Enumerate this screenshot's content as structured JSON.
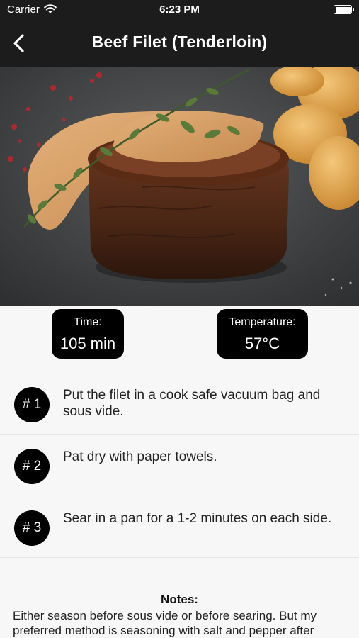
{
  "status_bar": {
    "carrier": "Carrier",
    "time": "6:23 PM"
  },
  "nav": {
    "title": "Beef Filet (Tenderloin)"
  },
  "stats": {
    "time_label": "Time:",
    "time_value": "105 min",
    "temperature_label": "Temperature:",
    "temperature_value": "57°C"
  },
  "steps": [
    {
      "badge": "# 1",
      "text": "Put the filet in a cook safe vacuum bag and sous vide."
    },
    {
      "badge": "# 2",
      "text": "Pat dry with paper towels."
    },
    {
      "badge": "# 3",
      "text": "Sear in a pan for a 1-2 minutes on each side."
    }
  ],
  "notes": {
    "heading": "Notes:",
    "body": "Either season before sous vide or before searing. But my preferred method is seasoning with salt and pepper after"
  },
  "colors": {
    "bar": "#1c1c1c",
    "badge": "#000000",
    "background": "#f7f7f7"
  }
}
